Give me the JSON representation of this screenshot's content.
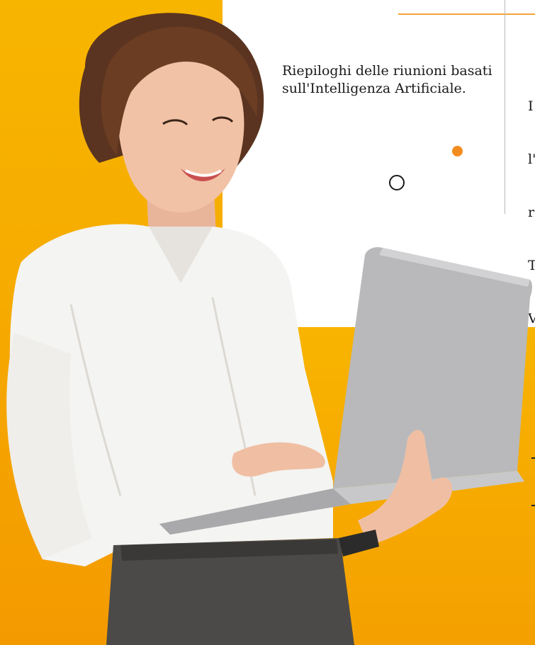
{
  "feature": {
    "text": "Riepiloghi delle riunioni basati sull'Intelligenza Artificiale."
  },
  "clipped_column": {
    "lines": [
      "I",
      "l'",
      "r",
      "T",
      "V"
    ]
  },
  "colors": {
    "accent": "#f28c1e",
    "background_yellow": "#f7b500",
    "text": "#1a1a1a"
  },
  "photo": {
    "subject": "woman-with-laptop-photo"
  }
}
